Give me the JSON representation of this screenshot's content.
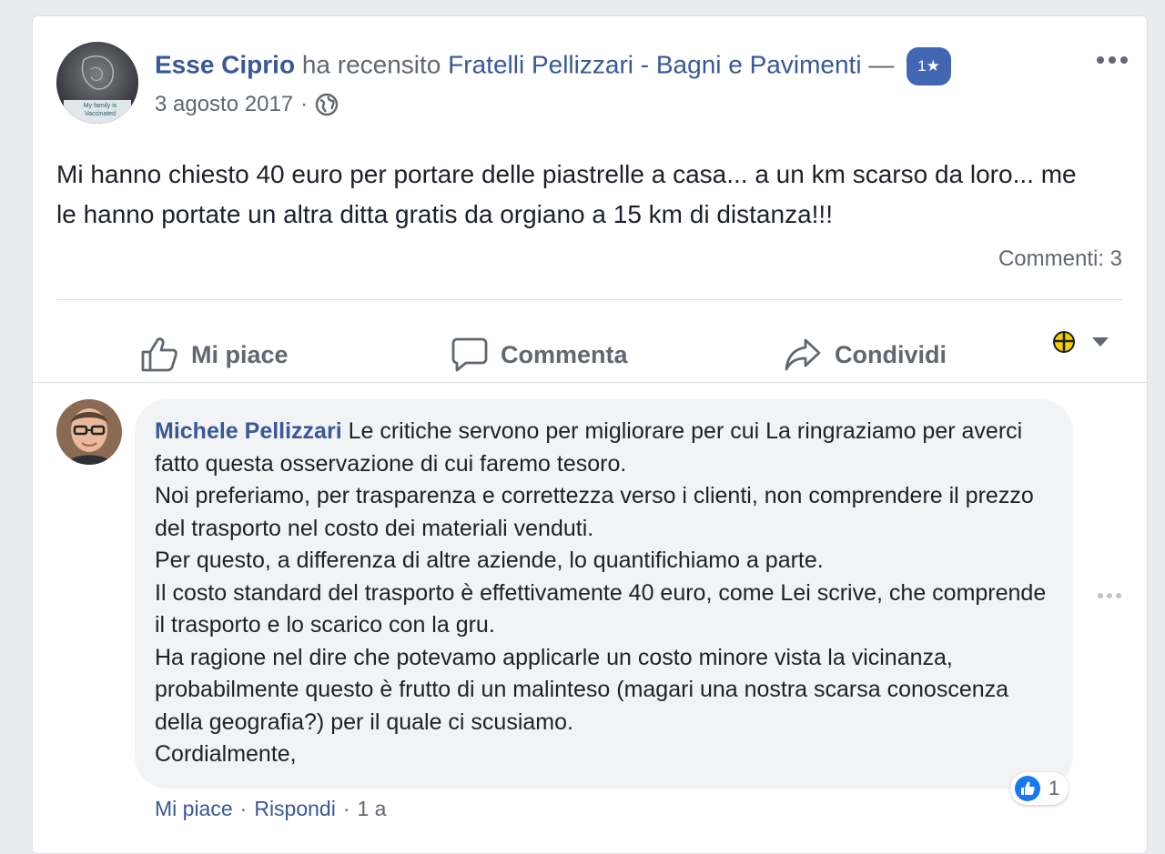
{
  "post": {
    "author": "Esse Ciprio",
    "action_text": "ha recensito",
    "page_name": "Fratelli Pellizzari - Bagni e Pavimenti",
    "separator": "—",
    "rating": "1★",
    "date": "3 agosto 2017",
    "dot": "·",
    "privacy_icon": "globe-icon",
    "avatar_caption": "My family is Vaccinated",
    "text": "Mi hanno chiesto 40 euro per portare delle piastrelle a casa... a un km scarso da loro... me le hanno portate un altra ditta gratis da orgiano a 15 km di distanza!!!",
    "comments_count": "Commenti: 3"
  },
  "actions": {
    "like": "Mi piace",
    "comment": "Commenta",
    "share": "Condividi"
  },
  "comment": {
    "author": "Michele Pellizzari",
    "text": "Le critiche servono per migliorare per cui La ringraziamo per averci fatto questa osservazione di cui faremo tesoro.\nNoi preferiamo, per trasparenza e correttezza verso i clienti, non comprendere il prezzo del trasporto nel costo dei materiali venduti.\nPer questo, a differenza di altre aziende, lo quantifichiamo a parte.\nIl costo standard del trasporto è effettivamente 40 euro, come Lei scrive, che comprende il trasporto e lo scarico con la gru.\nHa ragione nel dire che potevamo applicarle un costo minore vista la vicinanza, probabilmente questo è frutto di un malinteso (magari una nostra scarsa conoscenza della geografia?) per il quale ci scusiamo.\nCordialmente,",
    "reaction_count": "1",
    "like_label": "Mi piace",
    "reply_label": "Rispondi",
    "dot": "·",
    "time": "1 a"
  },
  "colors": {
    "link": "#385898",
    "muted": "#606770",
    "accent": "#4267b2",
    "bubble": "#f2f3f5"
  }
}
